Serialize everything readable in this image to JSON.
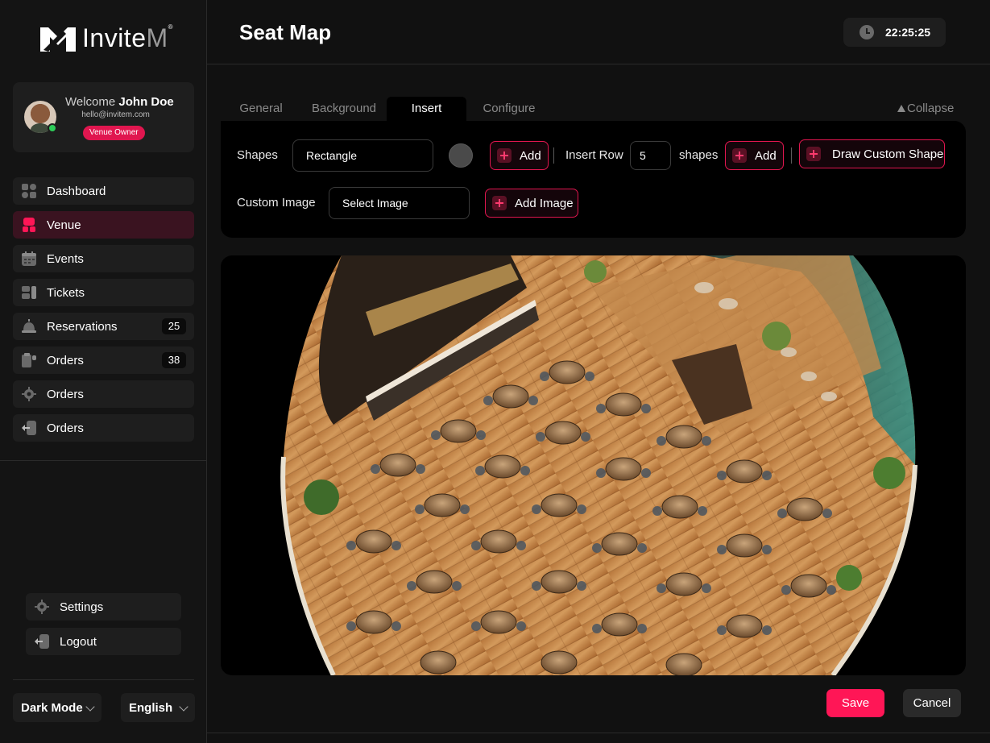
{
  "brand": {
    "name_main": "Invite",
    "name_accent": "M",
    "trademark": "®"
  },
  "profile": {
    "welcome": "Welcome",
    "name": "John Doe",
    "email": "hello@invitem.com",
    "role": "Venue Owner"
  },
  "nav": {
    "items": [
      {
        "label": "Dashboard",
        "icon": "grid-icon"
      },
      {
        "label": "Venue",
        "icon": "venue-icon",
        "active": true
      },
      {
        "label": "Events",
        "icon": "calendar-icon"
      },
      {
        "label": "Tickets",
        "icon": "ticket-icon"
      },
      {
        "label": "Reservations",
        "icon": "bell-icon",
        "badge": "25"
      },
      {
        "label": "Orders",
        "icon": "orders-icon",
        "badge": "38"
      },
      {
        "label": "Orders",
        "icon": "gear-icon"
      },
      {
        "label": "Orders",
        "icon": "exit-icon"
      }
    ]
  },
  "bottom_nav": {
    "settings": "Settings",
    "logout": "Logout"
  },
  "preferences": {
    "theme": "Dark Mode",
    "language": "English"
  },
  "header": {
    "title": "Seat Map",
    "time": "22:25:25"
  },
  "tabs": [
    "General",
    "Background",
    "Insert",
    "Configure"
  ],
  "active_tab": "Insert",
  "collapse_label": "Collapse",
  "insert": {
    "shapes_label": "Shapes",
    "shape_value": "Rectangle",
    "add_label": "Add",
    "insert_row_label": "Insert Row",
    "row_count": "5",
    "shapes_suffix": "shapes",
    "add_row_label": "Add",
    "draw_custom_label": "Draw Custom Shape",
    "custom_image_label": "Custom Image",
    "select_image_value": "Select Image",
    "add_image_label": "Add Image"
  },
  "actions": {
    "save": "Save",
    "cancel": "Cancel"
  },
  "colors": {
    "accent": "#e0164f",
    "save": "#ff1656",
    "background": "#111111",
    "panel": "#000000"
  }
}
